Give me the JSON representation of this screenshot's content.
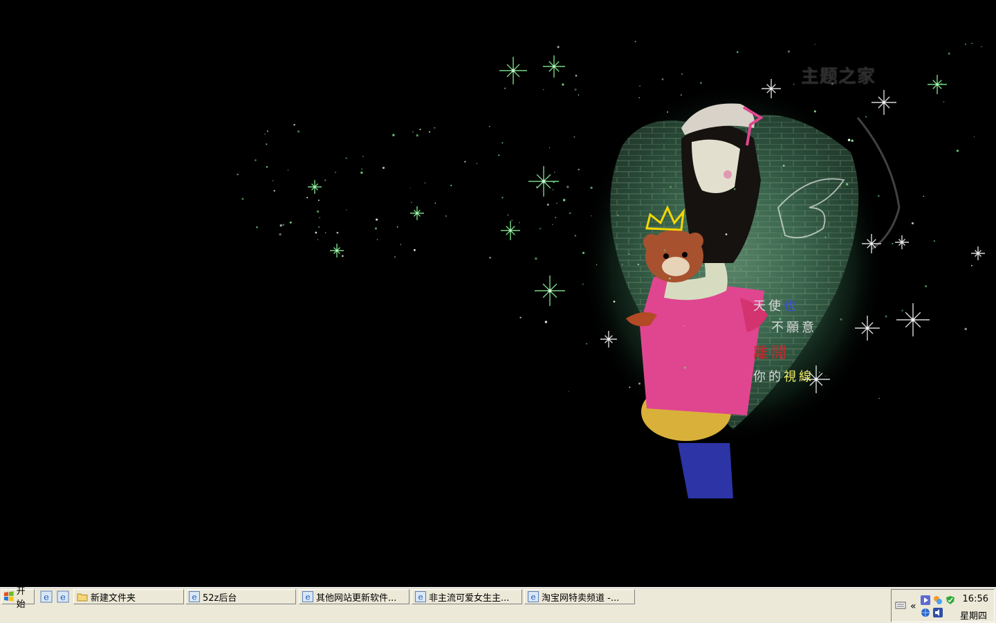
{
  "wallpaper": {
    "watermark": "主题之家",
    "poem": [
      {
        "text": "天使也",
        "colors": [
          "#d9d9d9",
          "#d9d9d9",
          "#3a4fd6"
        ]
      },
      {
        "text": "不願意",
        "colors": [
          "#d9d9d9",
          "#d9d9d9",
          "#d9d9d9"
        ]
      },
      {
        "text": "離開",
        "colors": [
          "#c0282e",
          "#c0282e"
        ]
      },
      {
        "text": "你的視線",
        "colors": [
          "#d9d9d9",
          "#d9d9d9",
          "#f0ee6a",
          "#f0ee6a"
        ]
      }
    ]
  },
  "taskbar": {
    "start_label": "开始",
    "quick_launch": [
      {
        "icon": "ie-icon"
      },
      {
        "icon": "ie-icon"
      }
    ],
    "tasks": [
      {
        "icon": "folder-icon",
        "label": "新建文件夹"
      },
      {
        "icon": "ie-icon",
        "label": "52z后台"
      },
      {
        "icon": "ie-icon",
        "label": "其他网站更新软件..."
      },
      {
        "icon": "ie-icon",
        "label": "非主流可爱女生主..."
      },
      {
        "icon": "ie-icon",
        "label": "淘宝网特卖频道 -..."
      }
    ],
    "tray": {
      "expand_label": "«",
      "time": "16:56",
      "day": "星期四"
    }
  },
  "colors": {
    "desktop_bg": "#000000",
    "taskbar_bg": "#ece9d8",
    "glow": "#3f6e54",
    "shirt": "#e0468f"
  }
}
